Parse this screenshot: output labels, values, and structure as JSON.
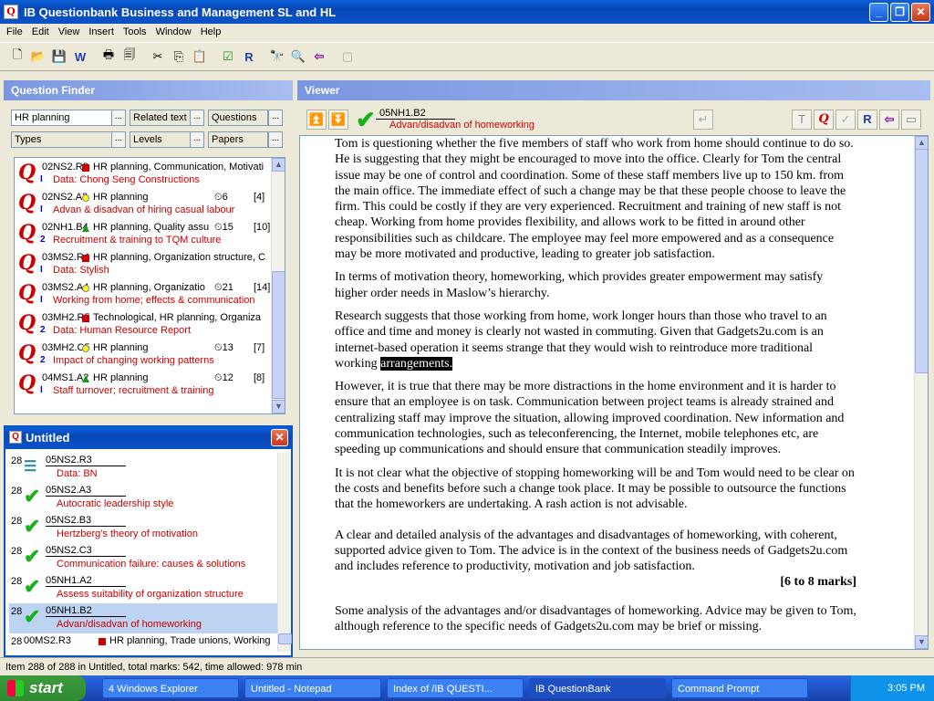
{
  "window": {
    "title": "IB Questionbank Business and Management SL and HL",
    "icon": "question-icon"
  },
  "menu": [
    "File",
    "Edit",
    "View",
    "Insert",
    "Tools",
    "Window",
    "Help"
  ],
  "finder": {
    "title": "Question Finder",
    "filters": [
      {
        "label": "HR planning",
        "editable": true
      },
      {
        "label": "Related text",
        "editable": false
      },
      {
        "label": "Questions",
        "editable": false
      },
      {
        "label": "Types",
        "editable": false
      },
      {
        "label": "Levels",
        "editable": false
      },
      {
        "label": "Papers",
        "editable": false
      }
    ],
    "browse_label": "...",
    "items": [
      {
        "code": "02NS2.R2",
        "mark": "red",
        "topic": "HR planning, Communication, Motivati",
        "time": "",
        "marks": "",
        "level": "I",
        "desc": "Data: Chong Seng Constructions"
      },
      {
        "code": "02NS2.A2",
        "mark": "yel",
        "topic": "HR planning",
        "time": "⏲6",
        "marks": "[4]",
        "level": "I",
        "desc": "Advan & disadvan of hiring casual labour"
      },
      {
        "code": "02NH1.B4",
        "mark": "tri",
        "topic": "HR planning, Quality assu",
        "time": "⏲15",
        "marks": "[10]",
        "level": "2",
        "desc": "Recruitment & training to TQM culture"
      },
      {
        "code": "03MS2.R4",
        "mark": "red",
        "topic": "HR planning, Organization structure, C",
        "time": "",
        "marks": "",
        "level": "I",
        "desc": "Data: Stylish"
      },
      {
        "code": "03MS2.A4",
        "mark": "yel",
        "topic": "HR planning, Organizatio",
        "time": "⏲21",
        "marks": "[14]",
        "level": "I",
        "desc": "Working from home; effects & communication"
      },
      {
        "code": "03MH2.R5",
        "mark": "red",
        "topic": "Technological, HR planning, Organiza",
        "time": "",
        "marks": "",
        "level": "2",
        "desc": "Data: Human Resource Report"
      },
      {
        "code": "03MH2.C5",
        "mark": "yel",
        "topic": "HR planning",
        "time": "⏲13",
        "marks": "[7]",
        "level": "2",
        "desc": "Impact of changing working patterns"
      },
      {
        "code": "04MS1.A2",
        "mark": "tri",
        "topic": "HR planning",
        "time": "⏲12",
        "marks": "[8]",
        "level": "I",
        "desc": "Staff turnover; recruitment & training"
      }
    ]
  },
  "untitled": {
    "title": "Untitled",
    "items": [
      {
        "num": "28",
        "code": "05NS2.R3",
        "desc": "Data: BN",
        "icon": "lines-icon",
        "sel": false
      },
      {
        "num": "28",
        "code": "05NS2.A3",
        "desc": "Autocratic leadership style",
        "icon": "check-icon",
        "sel": false
      },
      {
        "num": "28",
        "code": "05NS2.B3",
        "desc": "Hertzberg's theory of motivation",
        "icon": "check-icon",
        "sel": false
      },
      {
        "num": "28",
        "code": "05NS2.C3",
        "desc": "Communication failure: causes & solutions",
        "icon": "check-icon",
        "sel": false
      },
      {
        "num": "28",
        "code": "05NH1.A2",
        "desc": "Assess suitability of organization structure",
        "icon": "check-icon",
        "sel": false
      },
      {
        "num": "28",
        "code": "05NH1.B2",
        "desc": "Advan/disadvan of homeworking",
        "icon": "check-icon",
        "sel": true
      },
      {
        "num": "28",
        "code": "00MS2.R3",
        "desc": "HR planning, Trade unions, Working c",
        "icon": "red-square-icon",
        "sel": false
      }
    ]
  },
  "viewer": {
    "title": "Viewer",
    "current_code": "05NH1.B2",
    "current_desc": "Advan/disadvan of homeworking",
    "paragraphs": [
      "Tom is questioning whether the five members of staff who work from home should continue to do so. He is suggesting that they might be encouraged to move into the office. Clearly for Tom the central issue may be one of control and coordination. Some of these staff members live up to 150 km. from the main office. The immediate effect of such a change may be that these people choose to leave the firm. This could be costly if they are very experienced. Recruitment and training of new staff is not cheap. Working from home provides flexibility, and allows work to be fitted in around other responsibilities such as childcare. The employee may feel more empowered and as a consequence may be more motivated and productive, leading to greater job satisfaction.",
      "In terms of motivation theory, homeworking, which provides greater empowerment may satisfy higher order needs in Maslow’s hierarchy.",
      "Research suggests that those working from home, work longer hours than those who travel to an office and time and money is clearly not wasted in commuting. Given that Gadgets2u.com is an internet-based operation it seems strange that they would wish to reintroduce more traditional working",
      "However, it is true that there may be more distractions in the home environment and it is harder to ensure that an employee is on task. Communication between project teams is already strained and centralizing staff may improve the situation, allowing improved coordination. New information and communication technologies, such as teleconferencing, the Internet, mobile telephones etc, are speeding up communications and should ensure that communication steadily improves.",
      "It is not clear what the objective of stopping homeworking will be and Tom would need to be clear on the costs and benefits before such a change took place. It may be possible to outsource the functions that the homeworkers are undertaking. A rash action is not advisable.",
      "A clear and detailed analysis of the advantages and disadvantages of homeworking, with coherent, supported advice given to Tom. The advice is in the context of the business needs of Gadgets2u.com and includes reference to productivity, motivation and job satisfaction.",
      "Some analysis of the advantages and/or disadvantages of homeworking. Advice may be given to Tom, although reference to the specific needs of Gadgets2u.com may be brief or missing."
    ],
    "highlight": "arrangements.",
    "marks_label": "[6 to 8 marks]"
  },
  "status": "Item 288 of 288 in Untitled, total marks: 542, time allowed: 978 min",
  "taskbar": {
    "start": "start",
    "tasks": [
      "4 Windows Explorer",
      "Untitled - Notepad",
      "Index of /IB QUESTI...",
      "IB QuestionBank",
      "Command Prompt"
    ],
    "clock": "3:05 PM"
  }
}
